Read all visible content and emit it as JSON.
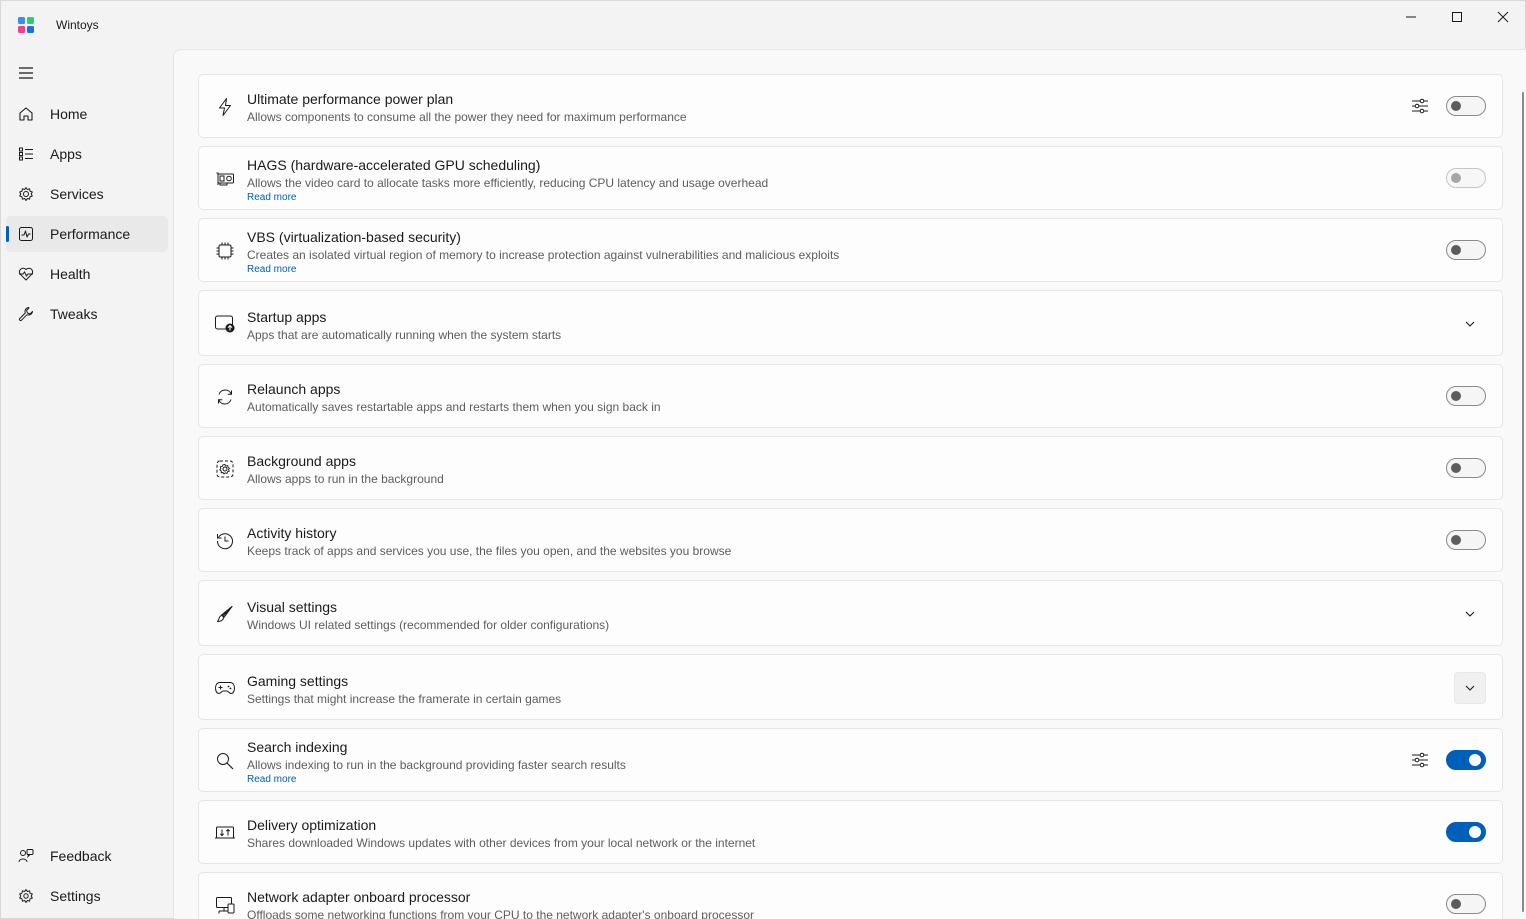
{
  "window": {
    "title": "Wintoys",
    "controls": [
      "minimize-icon",
      "maximize-icon",
      "close-icon"
    ]
  },
  "sidebar": {
    "menu_icon": "hamburger-icon",
    "items": [
      {
        "label": "Home",
        "icon": "home-icon",
        "active": false
      },
      {
        "label": "Apps",
        "icon": "apps-list-icon",
        "active": false
      },
      {
        "label": "Services",
        "icon": "services-gear-icon",
        "active": false
      },
      {
        "label": "Performance",
        "icon": "performance-chart-icon",
        "active": true
      },
      {
        "label": "Health",
        "icon": "health-heart-icon",
        "active": false
      },
      {
        "label": "Tweaks",
        "icon": "wrench-icon",
        "active": false
      }
    ],
    "footer": [
      {
        "label": "Feedback",
        "icon": "feedback-icon"
      },
      {
        "label": "Settings",
        "icon": "settings-gear-icon"
      }
    ]
  },
  "settings": [
    {
      "title": "Ultimate performance power plan",
      "description": "Allows components to consume all the power they need for maximum performance",
      "link": "",
      "icon": "lightning-icon",
      "control": "toggle",
      "state": "off",
      "tune": true
    },
    {
      "title": "HAGS (hardware-accelerated GPU scheduling)",
      "description": "Allows the video card to allocate tasks more efficiently, reducing CPU latency and usage overhead",
      "link": "Read more",
      "icon": "gpu-icon",
      "control": "toggle",
      "state": "disabled",
      "tune": false
    },
    {
      "title": "VBS (virtualization-based security)",
      "description": "Creates an isolated virtual region of memory to increase protection against vulnerabilities and malicious exploits",
      "link": "Read more",
      "icon": "chip-icon",
      "control": "toggle",
      "state": "off",
      "tune": false
    },
    {
      "title": "Startup apps",
      "description": "Apps that are automatically running when the system starts",
      "link": "",
      "icon": "startup-icon",
      "control": "expander",
      "state": "collapsed",
      "tune": false
    },
    {
      "title": "Relaunch apps",
      "description": "Automatically saves restartable apps and restarts them when you sign back in",
      "link": "",
      "icon": "relaunch-arrows-icon",
      "control": "toggle",
      "state": "off",
      "tune": false
    },
    {
      "title": "Background apps",
      "description": "Allows apps to run in the background",
      "link": "",
      "icon": "background-apps-icon",
      "control": "toggle",
      "state": "off",
      "tune": false
    },
    {
      "title": "Activity history",
      "description": "Keeps track of apps and services you use, the files you open, and the websites you browse",
      "link": "",
      "icon": "history-icon",
      "control": "toggle",
      "state": "off",
      "tune": false
    },
    {
      "title": "Visual settings",
      "description": "Windows UI related settings (recommended for older configurations)",
      "link": "",
      "icon": "brush-icon",
      "control": "expander",
      "state": "collapsed",
      "tune": false
    },
    {
      "title": "Gaming settings",
      "description": "Settings that might increase the framerate in certain games",
      "link": "",
      "icon": "gamepad-icon",
      "control": "expander",
      "state": "hover",
      "tune": false
    },
    {
      "title": "Search indexing",
      "description": "Allows indexing to run in the background providing faster search results",
      "link": "Read more",
      "icon": "search-icon",
      "control": "toggle",
      "state": "on",
      "tune": true
    },
    {
      "title": "Delivery optimization",
      "description": "Shares downloaded Windows updates with other devices from your local network or the internet",
      "link": "",
      "icon": "delivery-icon",
      "control": "toggle",
      "state": "on",
      "tune": false
    },
    {
      "title": "Network adapter onboard processor",
      "description": "Offloads some networking functions from your CPU to the network adapter's onboard processor",
      "link": "",
      "icon": "network-adapter-icon",
      "control": "toggle",
      "state": "off",
      "tune": false
    }
  ],
  "colors": {
    "accent": "#005fb8",
    "window_bg": "#f3f3f3",
    "content_bg": "#f9f9f9",
    "card_bg": "#fdfdfd"
  }
}
